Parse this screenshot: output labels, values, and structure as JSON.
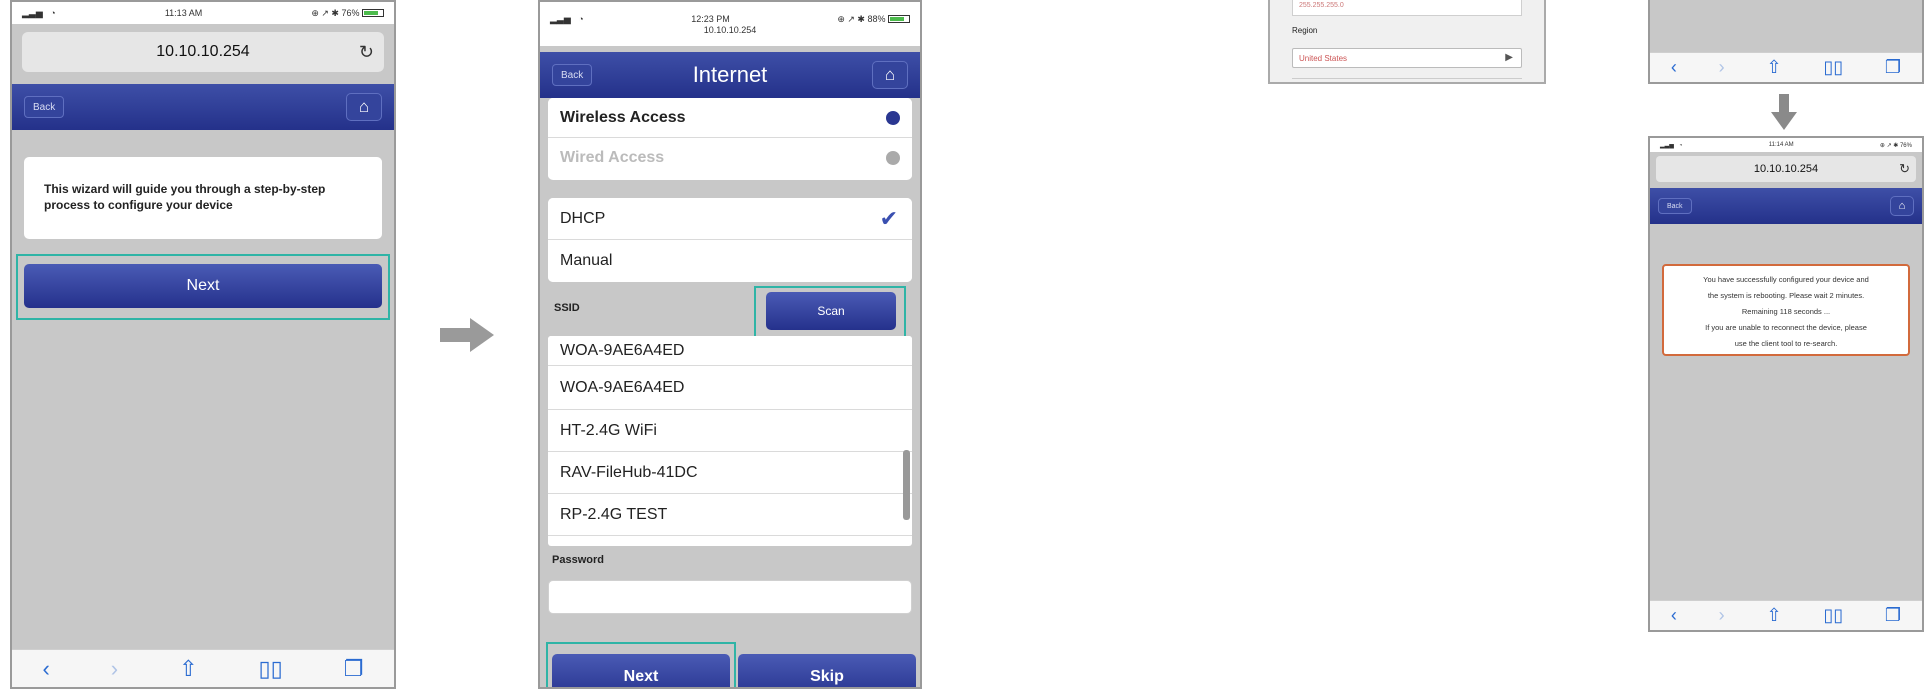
{
  "phone1": {
    "status": {
      "time": "11:13 AM",
      "battery": "76%"
    },
    "url": "10.10.10.254",
    "back_label": "Back",
    "message": "This wizard will guide you through a step-by-step process to configure your device",
    "next_label": "Next"
  },
  "phone2": {
    "status": {
      "time": "12:23 PM",
      "url_small": "10.10.10.254",
      "battery": "88%"
    },
    "title": "Internet",
    "back_label": "Back",
    "access": [
      {
        "label": "Wireless Access",
        "selected": true
      },
      {
        "label": "Wired Access",
        "selected": false
      }
    ],
    "modes": [
      "DHCP",
      "Manual"
    ],
    "ssid_label": "SSID",
    "scan_label": "Scan",
    "networks": [
      "WOA-9AE6A4ED",
      "WOA-9AE6A4ED",
      "HT-2.4G WiFi",
      "RAV-FileHub-41DC",
      "RP-2.4G TEST"
    ],
    "password_label": "Password",
    "next_label": "Next",
    "skip_label": "Skip"
  },
  "phone3": {
    "field_value": "255.255.255.0",
    "region_label": "Region",
    "region_value": "United States"
  },
  "phone4": {
    "status": {
      "time": "11:14 AM",
      "battery": "76%"
    },
    "url": "10.10.10.254",
    "back_label": "Back",
    "message_lines": [
      "You have successfully configured your device and",
      "the system is rebooting. Please wait 2 minutes.",
      "Remaining 118 seconds ...",
      "If you are unable to reconnect the device, please",
      "use the client tool to re-search."
    ]
  },
  "colors": {
    "accent": "#2fb4a6",
    "nav": "#2a3791",
    "arrow": "#9a9a9a"
  }
}
